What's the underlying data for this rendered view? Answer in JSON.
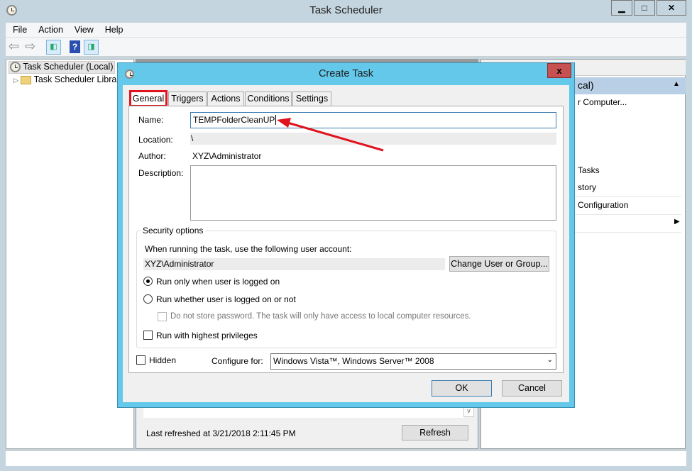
{
  "window": {
    "title": "Task Scheduler",
    "minimize": "▁",
    "maximize": "□",
    "close": "✕"
  },
  "menu": [
    "File",
    "Action",
    "View",
    "Help"
  ],
  "toolbar": {
    "back": "⇦",
    "forward": "⇨",
    "help": "?"
  },
  "tree": {
    "root": "Task Scheduler (Local)",
    "library": "Task Scheduler Library"
  },
  "actions_pane": {
    "header": "cal)",
    "items": [
      "r Computer...",
      "Tasks",
      "story",
      "Configuration"
    ]
  },
  "middle": {
    "last_refreshed": "Last refreshed at 3/21/2018 2:11:45 PM",
    "refresh": "Refresh"
  },
  "dialog": {
    "title": "Create Task",
    "close": "x",
    "tabs": [
      "General",
      "Triggers",
      "Actions",
      "Conditions",
      "Settings"
    ],
    "active_tab": "General",
    "highlight_color": "#e0141e",
    "name_label": "Name:",
    "name_value": "TEMPFolderCleanUP",
    "location_label": "Location:",
    "location_value": "\\",
    "author_label": "Author:",
    "author_value": "XYZ\\Administrator",
    "description_label": "Description:",
    "description_value": "",
    "security": {
      "legend": "Security options",
      "account_prompt": "When running the task, use the following user account:",
      "account": "XYZ\\Administrator",
      "change_button": "Change User or Group...",
      "radio_logged_on": "Run only when user is logged on",
      "radio_whether": "Run whether user is logged on or not",
      "no_store_password": "Do not store password.  The task will only have access to local computer resources.",
      "highest_privileges": "Run with highest privileges"
    },
    "hidden_label": "Hidden",
    "configure_label": "Configure for:",
    "configure_value": "Windows Vista™, Windows Server™ 2008",
    "ok": "OK",
    "cancel": "Cancel"
  }
}
